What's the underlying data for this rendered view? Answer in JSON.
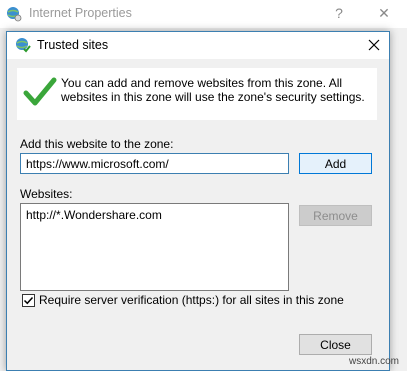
{
  "parent_window": {
    "title": "Internet Properties",
    "icon": "globe-settings-icon"
  },
  "dialog": {
    "title": "Trusted sites",
    "icon": "globe-check-icon",
    "info_text": "You can add and remove websites from this zone. All websites in this zone will use the zone's security settings.",
    "info_icon": "green-check-icon",
    "add_label": "Add this website to the zone:",
    "add_value": "https://www.microsoft.com/",
    "add_button": "Add",
    "websites_label": "Websites:",
    "websites": [
      "http://*.Wondershare.com"
    ],
    "remove_button": "Remove",
    "require_verification_label": "Require server verification (https:) for all sites in this zone",
    "require_verification_checked": true,
    "close_button": "Close"
  },
  "watermark": "wsxdn.com",
  "colors": {
    "accent": "#0078d7",
    "window_bg": "#f0f0f0",
    "check_green": "#3aa63a"
  }
}
